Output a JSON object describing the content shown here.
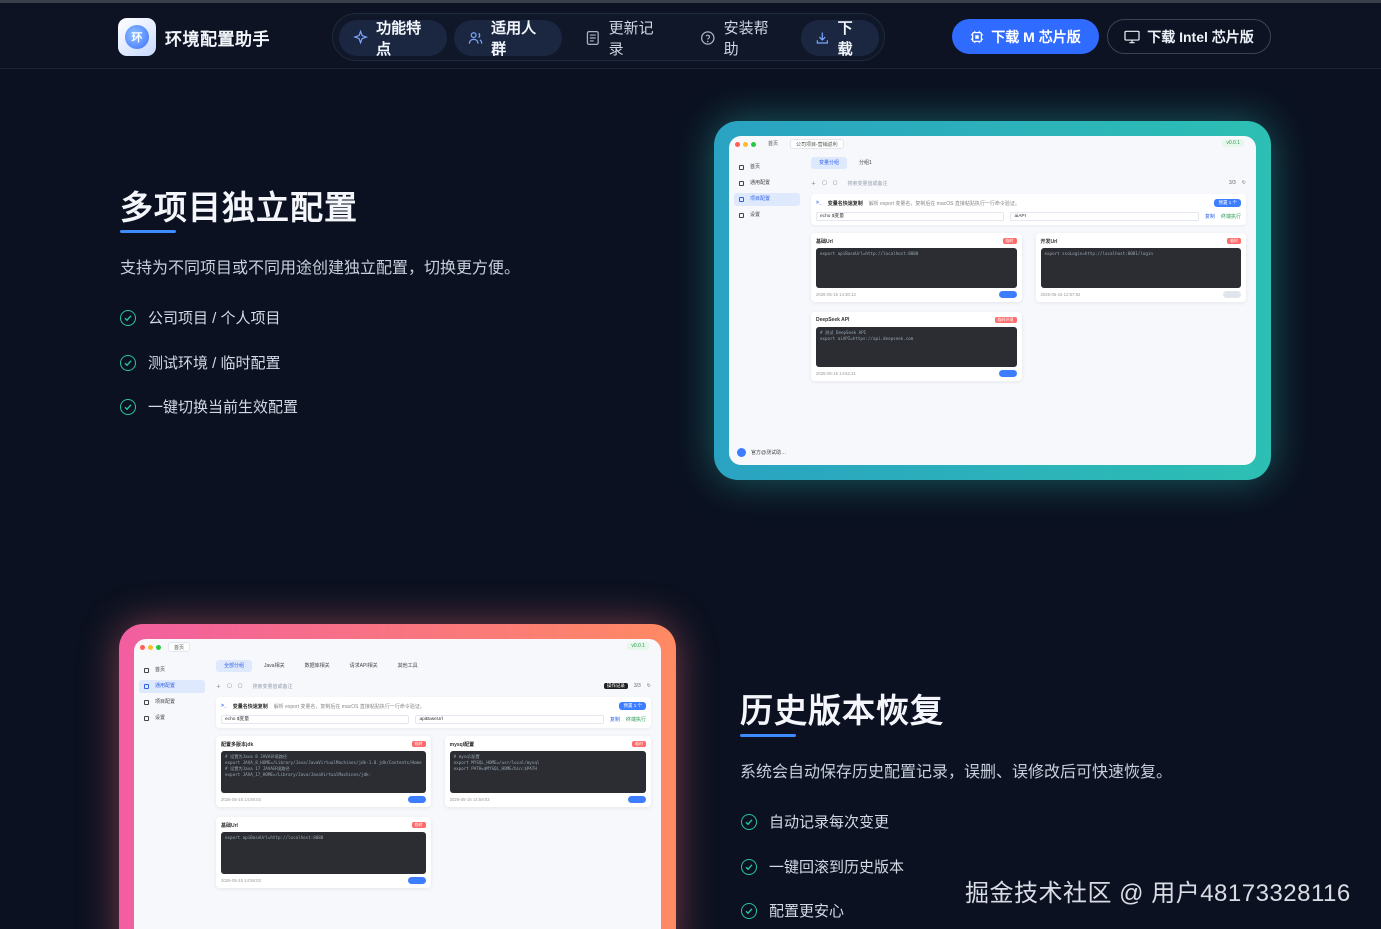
{
  "brand": {
    "name": "环境配置助手",
    "logo_text": "环"
  },
  "nav": {
    "items": [
      {
        "label": "功能特点",
        "icon": "sparkle-icon"
      },
      {
        "label": "适用人群",
        "icon": "users-icon"
      },
      {
        "label": "更新记录",
        "icon": "document-icon"
      },
      {
        "label": "安装帮助",
        "icon": "help-icon"
      },
      {
        "label": "下载",
        "icon": "download-icon"
      }
    ],
    "download_m": "下载 M 芯片版",
    "download_intel": "下载 Intel 芯片版"
  },
  "section1": {
    "title": "多项目独立配置",
    "desc": "支持为不同项目或不同用途创建独立配置，切换更方便。",
    "features": [
      "公司项目 / 个人项目",
      "测试环境 / 临时配置",
      "一键切换当前生效配置"
    ]
  },
  "section2": {
    "title": "历史版本恢复",
    "desc": "系统会自动保存历史配置记录，误删、误修改后可快速恢复。",
    "features": [
      "自动记录每次变更",
      "一键回滚到历史版本",
      "配置更安心"
    ]
  },
  "mock1": {
    "tabs_top": [
      "首页",
      "公司项目-营销返利"
    ],
    "version": "v0.0.1",
    "sidebar": [
      "首页",
      "通用配置",
      "项目配置",
      "设置"
    ],
    "group_tabs": [
      "变量分组",
      "分组1"
    ],
    "search_placeholder": "搜索变量值或备注",
    "page": "3/3",
    "quick_title": "变量名快速复制",
    "quick_hint": "解析 export 变量名，复制后在 macOS 直接粘贴执行一行命令验证。",
    "quick_btn": "预置 1 个",
    "quick_cmd": "echo $变量",
    "quick_var": "aiAPI",
    "copy_btn": "复制",
    "run_btn": "终端执行",
    "footer": "官方@测试助…",
    "cards": [
      {
        "title": "基础Url",
        "tag": "临时",
        "code": "export apiBaseUrl=http://localhost:8080",
        "time": "2026-05-15 14:30:12",
        "on": true
      },
      {
        "title": "开发Url",
        "tag": "临时",
        "code": "export ssoLogin=http://localhost:8081/login",
        "time": "2026-05-15 12:57:52",
        "on": false
      },
      {
        "title": "DeepSeek API",
        "tag": "临时环境",
        "code": "# 测试 DeepSeek API\nexport aiAPI=https://api.deepseek.com",
        "time": "2026-05-15 14:52:21",
        "on": true
      }
    ]
  },
  "mock2": {
    "tabs_top": [
      "首页"
    ],
    "version": "v0.0.1",
    "sidebar": [
      "首页",
      "通用配置",
      "项目配置",
      "设置"
    ],
    "group_tabs": [
      "全部分组",
      "Java相关",
      "数据库相关",
      "请求API相关",
      "其他工具"
    ],
    "search_placeholder": "搜索变量值或备注",
    "tooltip": "操作记录",
    "page": "3/3",
    "quick_title": "变量名快速复制",
    "quick_hint": "解析 export 变量名，复制后在 macOS 直接粘贴执行一行命令验证。",
    "quick_btn": "预置 1 个",
    "quick_cmd": "echo $变量",
    "quick_var": "apiBaseUrl",
    "copy_btn": "复制",
    "run_btn": "终端执行",
    "cards": [
      {
        "title": "配置多版本jdk",
        "tag": "临时",
        "code": "# 设置为Java 8 JAVA环境路径\nexport JAVA_8_HOME=/Library/Java/JavaVirtualMachines/jdk-1.8.jdk/Contents/Home\n# 设置为Java 17 JAVA环境路径\nexport JAVA_17_HOME=/Library/Java/JavaVirtualMachines/jdk-",
        "time": "2026-05-15 14:59:03",
        "on": true
      },
      {
        "title": "mysql配置",
        "tag": "临时",
        "code": "# mysql配置\nexport MYSQL_HOME=/usr/local/mysql\nexport PATH=$MYSQL_HOME/bin:$PATH",
        "time": "2026-05-15 14:59:03",
        "on": true
      },
      {
        "title": "基础Url",
        "tag": "临时",
        "code": "export apiBaseUrl=http://localhost:8080",
        "time": "2026-05-15 14:59:03",
        "on": true
      }
    ]
  },
  "watermark": "掘金技术社区 @ 用户48173328116",
  "colors": {
    "accent": "#2f6bff",
    "check": "#28c4a8",
    "teal_frame": "#2dbfb3",
    "warm_frame": "#ff8a63"
  }
}
